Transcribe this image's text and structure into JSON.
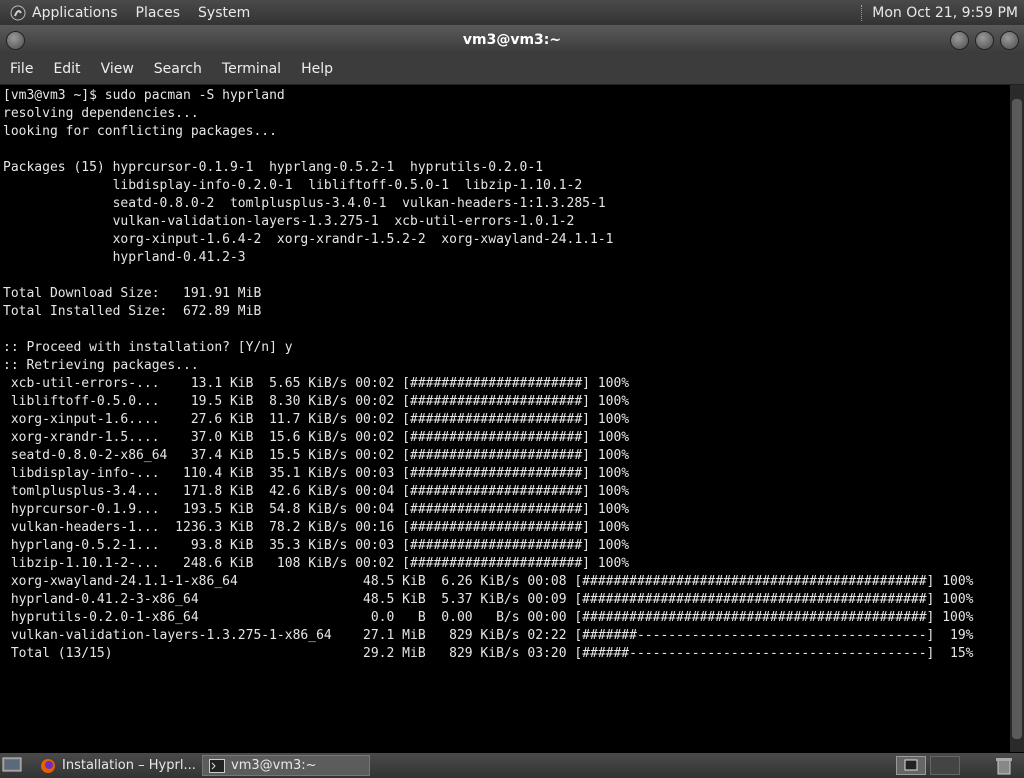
{
  "top_panel": {
    "menus": [
      "Applications",
      "Places",
      "System"
    ],
    "clock": "Mon Oct 21,  9:59 PM"
  },
  "window": {
    "title": "vm3@vm3:~"
  },
  "menu_bar": [
    "File",
    "Edit",
    "View",
    "Search",
    "Terminal",
    "Help"
  ],
  "terminal": {
    "lines": [
      "[vm3@vm3 ~]$ sudo pacman -S hyprland",
      "resolving dependencies...",
      "looking for conflicting packages...",
      "",
      "Packages (15) hyprcursor-0.1.9-1  hyprlang-0.5.2-1  hyprutils-0.2.0-1",
      "              libdisplay-info-0.2.0-1  libliftoff-0.5.0-1  libzip-1.10.1-2",
      "              seatd-0.8.0-2  tomlplusplus-3.4.0-1  vulkan-headers-1:1.3.285-1",
      "              vulkan-validation-layers-1.3.275-1  xcb-util-errors-1.0.1-2",
      "              xorg-xinput-1.6.4-2  xorg-xrandr-1.5.2-2  xorg-xwayland-24.1.1-1",
      "              hyprland-0.41.2-3",
      "",
      "Total Download Size:   191.91 MiB",
      "Total Installed Size:  672.89 MiB",
      "",
      ":: Proceed with installation? [Y/n] y",
      ":: Retrieving packages...",
      " xcb-util-errors-...    13.1 KiB  5.65 KiB/s 00:02 [######################] 100%",
      " libliftoff-0.5.0...    19.5 KiB  8.30 KiB/s 00:02 [######################] 100%",
      " xorg-xinput-1.6....    27.6 KiB  11.7 KiB/s 00:02 [######################] 100%",
      " xorg-xrandr-1.5....    37.0 KiB  15.6 KiB/s 00:02 [######################] 100%",
      " seatd-0.8.0-2-x86_64   37.4 KiB  15.5 KiB/s 00:02 [######################] 100%",
      " libdisplay-info-...   110.4 KiB  35.1 KiB/s 00:03 [######################] 100%",
      " tomlplusplus-3.4...   171.8 KiB  42.6 KiB/s 00:04 [######################] 100%",
      " hyprcursor-0.1.9...   193.5 KiB  54.8 KiB/s 00:04 [######################] 100%",
      " vulkan-headers-1...  1236.3 KiB  78.2 KiB/s 00:16 [######################] 100%",
      " hyprlang-0.5.2-1...    93.8 KiB  35.3 KiB/s 00:03 [######################] 100%",
      " libzip-1.10.1-2-...   248.6 KiB   108 KiB/s 00:02 [######################] 100%",
      " xorg-xwayland-24.1.1-1-x86_64                48.5 KiB  6.26 KiB/s 00:08 [############################################] 100%",
      " hyprland-0.41.2-3-x86_64                     48.5 KiB  5.37 KiB/s 00:09 [############################################] 100%",
      " hyprutils-0.2.0-1-x86_64                      0.0   B  0.00   B/s 00:00 [############################################] 100%",
      " vulkan-validation-layers-1.3.275-1-x86_64    27.1 MiB   829 KiB/s 02:22 [#######-------------------------------------]  19%",
      " Total (13/15)                                29.2 MiB   829 KiB/s 03:20 [######--------------------------------------]  15%"
    ]
  },
  "taskbar": {
    "tasks": [
      {
        "label": "Installation – Hyprl..."
      },
      {
        "label": "vm3@vm3:~"
      }
    ]
  }
}
